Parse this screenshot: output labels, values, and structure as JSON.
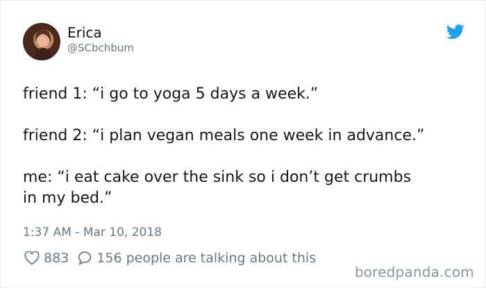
{
  "author": {
    "name": "Erica",
    "handle": "@SCbchbum"
  },
  "tweet": {
    "lines": [
      "friend 1: “i go to yoga 5 days a week.”",
      "friend 2: “i plan vegan meals one week in advance.”",
      "me: “i eat cake over the sink so i don’t get crumbs",
      "in my bed.”"
    ],
    "timestamp": "1:37 AM - Mar 10, 2018"
  },
  "engagement": {
    "likes": "883",
    "talking": "156 people are talking about this"
  },
  "icons": {
    "brand": "twitter-bird-icon",
    "like": "heart-icon",
    "reply": "speech-bubble-icon"
  },
  "colors": {
    "twitter_blue": "#1da1f2",
    "muted": "#657786"
  },
  "watermark": "boredpanda.com"
}
